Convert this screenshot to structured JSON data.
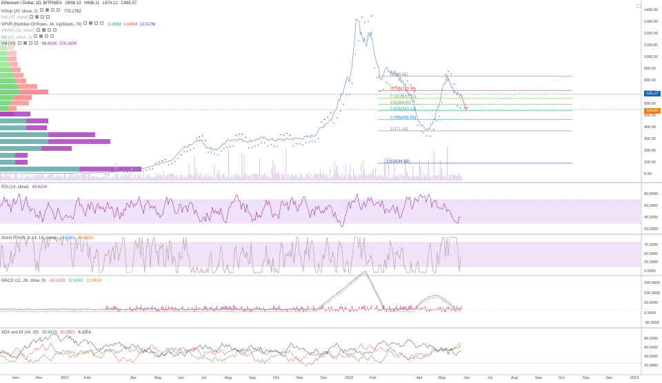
{
  "header": {
    "symbol": "Ethereum / Dollar, 1D, BITFINEX",
    "open": "O696.13",
    "high": "H698.11",
    "low": "L674.12",
    "close": "C685.37"
  },
  "main_legends": [
    {
      "name": "VStop (20, close, 2)",
      "v1": "770.1782",
      "v2": "",
      "v3": "",
      "c1": "#333",
      "c2": "#333",
      "c3": "#333"
    },
    {
      "name": "MA (20, close)",
      "v1": "",
      "v2": "",
      "v3": "",
      "c1": "#aaa",
      "c2": "#aaa",
      "c3": "#aaa"
    },
    {
      "name": "VPVR (Number Of Rows, 24, Up/Down, 70)",
      "v1": "3.289M",
      "v2": "3.649M",
      "v3": "13.027M",
      "c1": "#26a69a",
      "c2": "#ef5350",
      "c3": "#3949ab"
    },
    {
      "name": "VWMA (20, close)",
      "v1": "",
      "v2": "",
      "v3": "",
      "c1": "#aaa",
      "c2": "#aaa",
      "c3": "#aaa"
    },
    {
      "name": "BB (20, close, 2)",
      "v1": "",
      "v2": "",
      "v3": "",
      "c1": "#aaa",
      "c2": "#aaa",
      "c3": "#aaa"
    },
    {
      "name": "Vol (20)",
      "v1": "96.692K",
      "v2": "225.165K",
      "v3": "",
      "c1": "#9c27b0",
      "c2": "#9c27b0",
      "c3": "#333"
    }
  ],
  "price_tags": {
    "current": "685.37",
    "target": "549.60"
  },
  "fib_levels": [
    {
      "label": "0(836.67)",
      "price": 836.67,
      "color": "#888888"
    },
    {
      "label": "0.236(713.96)",
      "price": 713.96,
      "color": "#e53935"
    },
    {
      "label": "0.382(647.72)",
      "price": 647.72,
      "color": "#7cb342"
    },
    {
      "label": "0.5(594.92)",
      "price": 594.92,
      "color": "#43a047"
    },
    {
      "label": "0.618(542.13)",
      "price": 542.13,
      "color": "#26a69a"
    },
    {
      "label": "0.786(466.93)",
      "price": 466.93,
      "color": "#1e88e5"
    },
    {
      "label": "1(371.18)",
      "price": 371.18,
      "color": "#888888"
    },
    {
      "label": "1.618(94.68)",
      "price": 94.68,
      "color": "#3949ab"
    }
  ],
  "price_axis": [
    "1400.00",
    "1300.00",
    "1200.00",
    "1100.00",
    "1000.00",
    "900.00",
    "800.00",
    "700.00",
    "600.00",
    "500.00",
    "400.00",
    "300.00",
    "200.00",
    "100.00",
    "0.00"
  ],
  "rsi": {
    "name": "RSI (14, close)",
    "value": "49.6104",
    "axis": [
      "80.0000",
      "60.0000",
      "40.0000",
      "20.0000"
    ]
  },
  "stoch": {
    "name": "Stoch RSI (3, 3, 14, 14, close)",
    "k": "29.2063",
    "d": "29.0928",
    "axis": [
      "75.0000",
      "50.0000",
      "25.0000",
      "0.0000"
    ]
  },
  "macd": {
    "name": "MACD (12, 26, close, 9)",
    "hist": "-10.3378",
    "macd": "12.6241",
    "signal": "22.9619",
    "axis": [
      "150.0000",
      "100.0000",
      "50.0000",
      "0.0000",
      "-50.0000"
    ]
  },
  "adx": {
    "name": "ADX and DI (14, 20)",
    "adx": "18.9473",
    "plus": "20.2921",
    "minus": "6.1201",
    "axis": [
      "80.0000",
      "60.0000",
      "40.0000",
      "20.0000"
    ]
  },
  "time_axis": [
    "Nov",
    "Dec",
    "2017",
    "Feb",
    "Apr",
    "May",
    "Jun",
    "Jul",
    "Aug",
    "Sep",
    "Oct",
    "Nov",
    "Dec",
    "2018",
    "Feb",
    "Apr",
    "May",
    "Jun",
    "Jul",
    "Aug",
    "Sep",
    "Oct",
    "Nov",
    "Dec",
    "2019"
  ],
  "colors": {
    "up": "#26a69a",
    "down": "#ef5350",
    "price_line": "#6b8dd6",
    "rsi": "#9c27b0",
    "band_fill": "#ede0fa",
    "volume": "#d1b3e6",
    "vstop_up": "#2e7d32",
    "vstop_down": "#8b1a1a",
    "current_price": "#1565c0",
    "target_price": "#f57c00"
  },
  "chart_data": {
    "type": "line",
    "title": "Ethereum / Dollar, 1D, BITFINEX",
    "x": [
      "Nov",
      "Dec",
      "2017",
      "Feb",
      "Apr",
      "May",
      "Jun",
      "Jul",
      "Aug",
      "Sep",
      "Oct",
      "Nov",
      "Dec",
      "2018",
      "Feb",
      "Apr",
      "May",
      "Jun"
    ],
    "series": [
      {
        "values": [
          11,
          8,
          8,
          11,
          50,
          90,
          330,
          230,
          300,
          350,
          300,
          340,
          600,
          1300,
          900,
          400,
          760,
          685
        ]
      }
    ],
    "ylim": [
      0,
      1400
    ],
    "grid": true
  }
}
